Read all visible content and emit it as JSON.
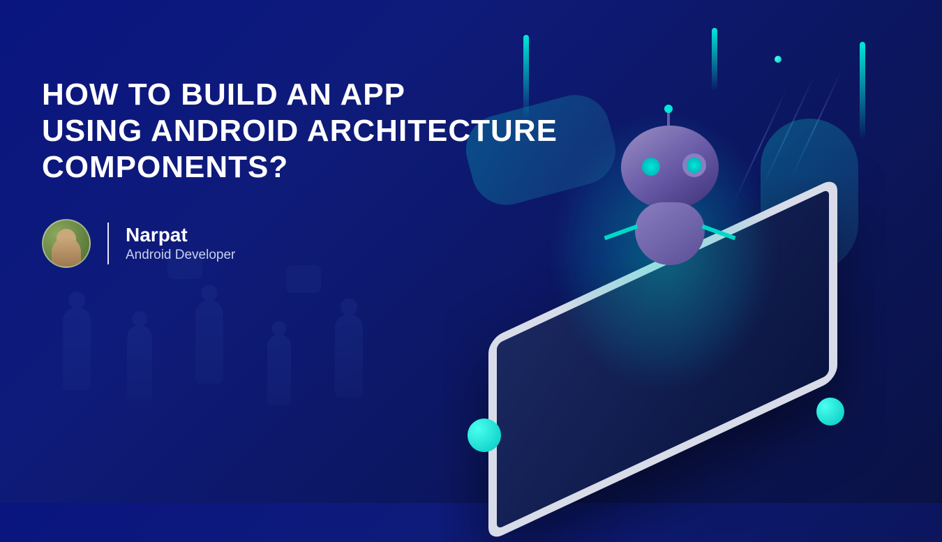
{
  "hero": {
    "title_line1": "How to Build an App",
    "title_line2": "Using Android Architecture",
    "title_line3": "Components?"
  },
  "author": {
    "name": "Narpat",
    "role": "Android Developer"
  }
}
